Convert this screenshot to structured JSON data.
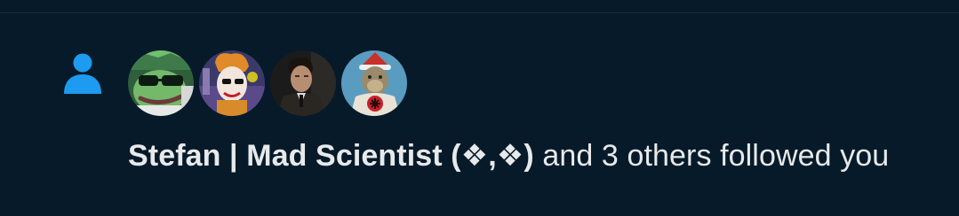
{
  "notification": {
    "type_icon": "person-icon",
    "accent_color": "#1d9bf0",
    "avatars": [
      {
        "icon": "green-frog-avatar"
      },
      {
        "icon": "joker-avatar"
      },
      {
        "icon": "man-in-suit-avatar"
      },
      {
        "icon": "santa-hat-ape-avatar"
      }
    ],
    "user_name": "Stefan | Mad Scientist (❖,❖)",
    "action_text": " and 3 others followed you"
  }
}
